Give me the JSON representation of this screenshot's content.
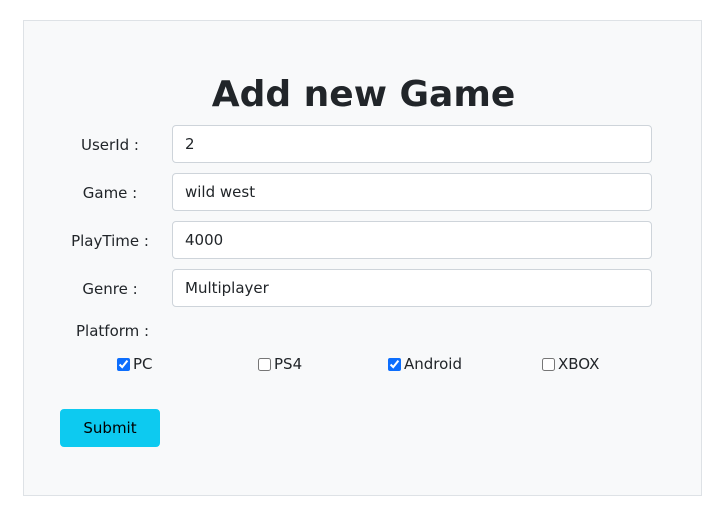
{
  "form": {
    "title": "Add new Game",
    "fields": [
      {
        "label": "UserId :",
        "value": "2"
      },
      {
        "label": "Game :",
        "value": "wild west"
      },
      {
        "label": "PlayTime :",
        "value": "4000"
      },
      {
        "label": "Genre :",
        "value": "Multiplayer"
      }
    ],
    "platform": {
      "label": "Platform :",
      "options": [
        {
          "label": "PC",
          "checked": true
        },
        {
          "label": "PS4",
          "checked": false
        },
        {
          "label": "Android",
          "checked": true
        },
        {
          "label": "XBOX",
          "checked": false
        }
      ]
    },
    "submit_label": "Submit"
  },
  "colors": {
    "card_background": "#f8f9fa",
    "submit_button": "#0dcaf0",
    "checkbox_accent": "#0d6efd"
  }
}
